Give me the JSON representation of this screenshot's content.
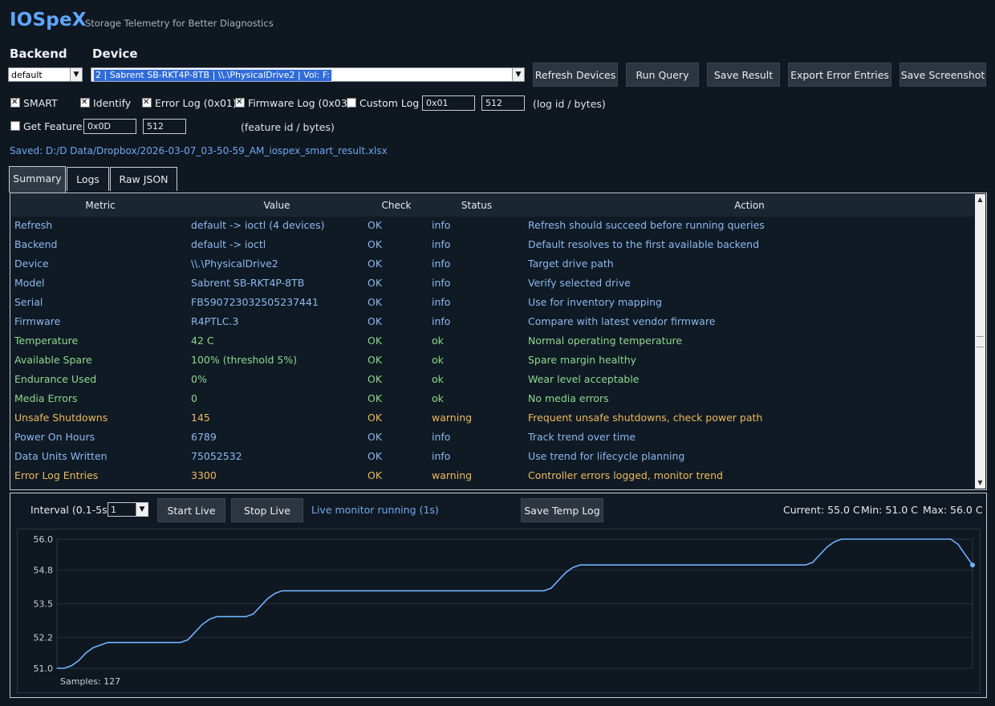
{
  "app": {
    "title": "IOSpeX",
    "subtitle": "Storage Telemetry for Better Diagnostics"
  },
  "backend": {
    "label": "Backend",
    "value": "default"
  },
  "device": {
    "label": "Device",
    "value": "2 | Sabrent SB-RKT4P-8TB | \\\\.\\PhysicalDrive2 | Vol: F:"
  },
  "toolbar": {
    "refresh": "Refresh Devices",
    "run": "Run Query",
    "save_result": "Save Result",
    "export": "Export Error Entries",
    "screenshot": "Save Screenshot"
  },
  "options": {
    "smart": {
      "label": "SMART",
      "checked": true
    },
    "identify": {
      "label": "Identify",
      "checked": true
    },
    "error_log": {
      "label": "Error Log (0x01)",
      "checked": true
    },
    "firmware_log": {
      "label": "Firmware Log (0x03)",
      "checked": true
    },
    "custom_log": {
      "label": "Custom Log",
      "checked": false,
      "id": "0x01",
      "bytes": "512",
      "hint": "(log id / bytes)"
    },
    "get_feature": {
      "label": "Get Feature",
      "checked": false,
      "id": "0x0D",
      "bytes": "512",
      "hint": "(feature id / bytes)"
    }
  },
  "saved_path": "Saved: D:/D Data/Dropbox/2026-03-07_03-50-59_AM_iospex_smart_result.xlsx",
  "tabs": [
    "Summary",
    "Logs",
    "Raw JSON"
  ],
  "table": {
    "headers": [
      "Metric",
      "Value",
      "Check",
      "Status",
      "Action"
    ],
    "rows": [
      {
        "metric": "Refresh",
        "value": "default -> ioctl (4 devices)",
        "check": "OK",
        "status": "info",
        "action": "Refresh should succeed before running queries"
      },
      {
        "metric": "Backend",
        "value": "default -> ioctl",
        "check": "OK",
        "status": "info",
        "action": "Default resolves to the first available backend"
      },
      {
        "metric": "Device",
        "value": "\\\\.\\PhysicalDrive2",
        "check": "OK",
        "status": "info",
        "action": "Target drive path"
      },
      {
        "metric": "Model",
        "value": "Sabrent SB-RKT4P-8TB",
        "check": "OK",
        "status": "info",
        "action": "Verify selected drive"
      },
      {
        "metric": "Serial",
        "value": "FB590723032505237441",
        "check": "OK",
        "status": "info",
        "action": "Use for inventory mapping"
      },
      {
        "metric": "Firmware",
        "value": "R4PTLC.3",
        "check": "OK",
        "status": "info",
        "action": "Compare with latest vendor firmware"
      },
      {
        "metric": "Temperature",
        "value": "42 C",
        "check": "OK",
        "status": "ok",
        "action": "Normal operating temperature"
      },
      {
        "metric": "Available Spare",
        "value": "100% (threshold 5%)",
        "check": "OK",
        "status": "ok",
        "action": "Spare margin healthy"
      },
      {
        "metric": "Endurance Used",
        "value": "0%",
        "check": "OK",
        "status": "ok",
        "action": "Wear level acceptable"
      },
      {
        "metric": "Media Errors",
        "value": "0",
        "check": "OK",
        "status": "ok",
        "action": "No media errors"
      },
      {
        "metric": "Unsafe Shutdowns",
        "value": "145",
        "check": "OK",
        "status": "warning",
        "action": "Frequent unsafe shutdowns, check power path"
      },
      {
        "metric": "Power On Hours",
        "value": "6789",
        "check": "OK",
        "status": "info",
        "action": "Track trend over time"
      },
      {
        "metric": "Data Units Written",
        "value": "75052532",
        "check": "OK",
        "status": "info",
        "action": "Use trend for lifecycle planning"
      },
      {
        "metric": "Error Log Entries",
        "value": "3300",
        "check": "OK",
        "status": "warning",
        "action": "Controller errors logged, monitor trend"
      }
    ]
  },
  "monitor": {
    "interval_label": "Interval (0.1-5s)",
    "interval_value": "1",
    "start": "Start Live",
    "stop": "Stop Live",
    "status": "Live monitor running (1s)",
    "save_log": "Save Temp Log",
    "current": "Current: 55.0 C",
    "min": "Min: 51.0 C",
    "max": "Max: 56.0 C",
    "samples": "Samples: 127"
  },
  "colors": {
    "accent": "#5ea6ff",
    "info": "#8db8f0",
    "ok": "#8fd88f",
    "warning": "#f0b95c",
    "line": "#6fb3ff"
  },
  "chart_data": {
    "type": "line",
    "ylim": [
      51.0,
      56.0
    ],
    "yticks": [
      "56.0",
      "54.8",
      "53.5",
      "52.2",
      "51.0"
    ],
    "series": [
      {
        "x": [
          0,
          1,
          2,
          3,
          4,
          5,
          6,
          7,
          8,
          9,
          10,
          11,
          12,
          13,
          14,
          15,
          16,
          17,
          18,
          19,
          20,
          21,
          22,
          23,
          24,
          25,
          26,
          27,
          28,
          29,
          30,
          31,
          32,
          33,
          34,
          35,
          36,
          37,
          38,
          39,
          40,
          41,
          42,
          43,
          44,
          45,
          46,
          47,
          48,
          49,
          50,
          51,
          52,
          53,
          54,
          55,
          56,
          57,
          58,
          59,
          60,
          61,
          62,
          63,
          64,
          65,
          66,
          67,
          68,
          69,
          70,
          71,
          72,
          73,
          74,
          75,
          76,
          77,
          78,
          79,
          80,
          81,
          82,
          83,
          84,
          85,
          86,
          87,
          88,
          89,
          90,
          91,
          92,
          93,
          94,
          95,
          96,
          97,
          98,
          99,
          100,
          101,
          102,
          103,
          104,
          105,
          106,
          107,
          108,
          109,
          110,
          111,
          112,
          113,
          114,
          115,
          116,
          117,
          118,
          119,
          120,
          121,
          122,
          123,
          124,
          125,
          126
        ],
        "values": [
          51.0,
          51.0,
          51.1,
          51.3,
          51.6,
          51.8,
          51.9,
          52.0,
          52.0,
          52.0,
          52.0,
          52.0,
          52.0,
          52.0,
          52.0,
          52.0,
          52.0,
          52.0,
          52.1,
          52.4,
          52.7,
          52.9,
          53.0,
          53.0,
          53.0,
          53.0,
          53.0,
          53.1,
          53.4,
          53.7,
          53.9,
          54.0,
          54.0,
          54.0,
          54.0,
          54.0,
          54.0,
          54.0,
          54.0,
          54.0,
          54.0,
          54.0,
          54.0,
          54.0,
          54.0,
          54.0,
          54.0,
          54.0,
          54.0,
          54.0,
          54.0,
          54.0,
          54.0,
          54.0,
          54.0,
          54.0,
          54.0,
          54.0,
          54.0,
          54.0,
          54.0,
          54.0,
          54.0,
          54.0,
          54.0,
          54.0,
          54.0,
          54.0,
          54.1,
          54.4,
          54.7,
          54.9,
          55.0,
          55.0,
          55.0,
          55.0,
          55.0,
          55.0,
          55.0,
          55.0,
          55.0,
          55.0,
          55.0,
          55.0,
          55.0,
          55.0,
          55.0,
          55.0,
          55.0,
          55.0,
          55.0,
          55.0,
          55.0,
          55.0,
          55.0,
          55.0,
          55.0,
          55.0,
          55.0,
          55.0,
          55.0,
          55.0,
          55.0,
          55.0,
          55.1,
          55.4,
          55.7,
          55.9,
          56.0,
          56.0,
          56.0,
          56.0,
          56.0,
          56.0,
          56.0,
          56.0,
          56.0,
          56.0,
          56.0,
          56.0,
          56.0,
          56.0,
          56.0,
          56.0,
          55.8,
          55.4,
          55.0
        ]
      }
    ]
  }
}
